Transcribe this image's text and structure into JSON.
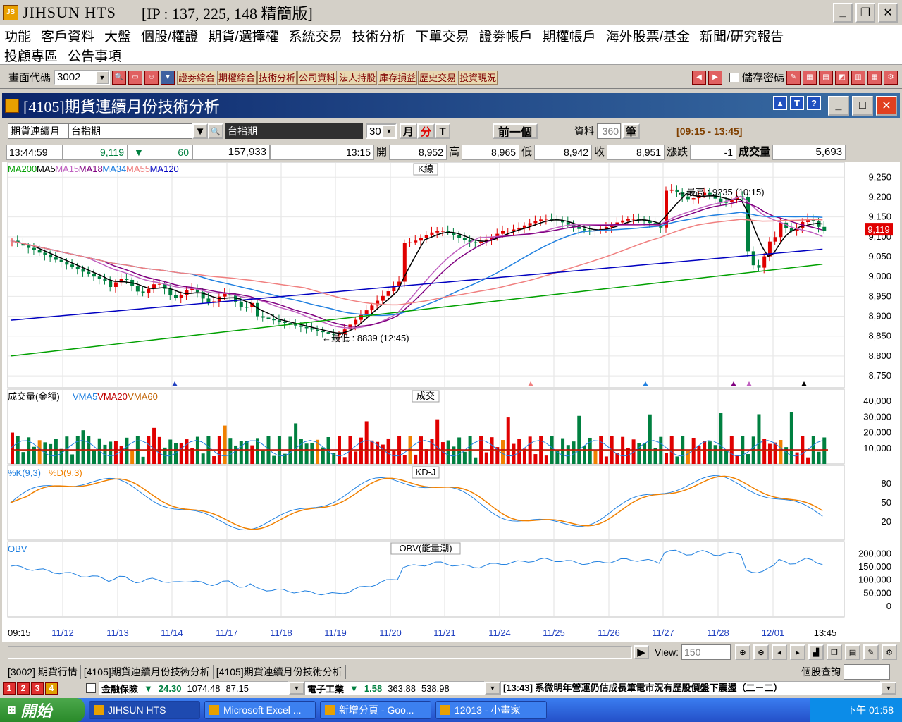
{
  "window": {
    "app_title": "JIHSUN HTS",
    "server_info": "[IP : 137, 225, 148 精簡版]"
  },
  "menu": {
    "row1": [
      "功能",
      "客戶資料",
      "大盤",
      "個股/權證",
      "期貨/選擇權",
      "系統交易",
      "技術分析",
      "下單交易",
      "證劵帳戶",
      "期權帳戶",
      "海外股票/基金",
      "新聞/研究報告"
    ],
    "row2": [
      "投顧專區",
      "公告事項"
    ]
  },
  "toolbar": {
    "code_label": "畫面代碼",
    "code_value": "3002",
    "shortcuts": [
      "證劵綜合",
      "期權綜合",
      "技術分析",
      "公司資料",
      "法人持股",
      "庫存損益",
      "歷史交易",
      "投資現況"
    ],
    "save_password_label": "儲存密碼"
  },
  "subwindow": {
    "title": "[4105]期貨連續月份技術分析"
  },
  "controls": {
    "product_type": "期貨連續月",
    "product_name": "台指期",
    "product_display": "台指期",
    "interval": "30",
    "unit_month": "月",
    "unit_minute": "分",
    "unit_tick": "T",
    "prev_button": "前一個",
    "data_label": "資料",
    "data_count": "360",
    "data_unit": "筆",
    "session": "[09:15 - 13:45]"
  },
  "quote": {
    "time": "13:44:59",
    "price": "9,119",
    "change": "60",
    "volume_total": "157,933",
    "bar_time": "13:15",
    "open_label": "開",
    "open": "8,952",
    "high_label": "高",
    "high": "8,965",
    "low_label": "低",
    "low": "8,942",
    "close_label": "收",
    "close": "8,951",
    "change_label": "漲跌",
    "bar_change": "-1",
    "vol_label": "成交量",
    "bar_volume": "5,693"
  },
  "chart_data": [
    {
      "type": "line",
      "title": "K線",
      "legend": [
        "MA200",
        "MA5",
        "MA15",
        "MA18",
        "MA34",
        "MA55",
        "MA120"
      ],
      "y_ticks": [
        "9,250",
        "9,200",
        "9,150",
        "9,100",
        "9,050",
        "9,000",
        "8,950",
        "8,900",
        "8,850",
        "8,800",
        "8,750"
      ],
      "ylim": [
        8720,
        9270
      ],
      "last_price_tag": "9,119",
      "annotations": [
        "最高 : 9235 (10:15)",
        "最低 : 8839 (12:45)"
      ],
      "x_labels": [
        "09:15",
        "11/12",
        "11/13",
        "11/14",
        "11/17",
        "11/18",
        "11/19",
        "11/20",
        "11/21",
        "11/24",
        "11/25",
        "11/26",
        "11/27",
        "11/28",
        "12/01",
        "13:45"
      ]
    },
    {
      "type": "bar",
      "title": "成交",
      "legend": [
        "成交量(金額)",
        "VMA5",
        "VMA20",
        "VMA60"
      ],
      "y_ticks": [
        "40,000",
        "30,000",
        "20,000",
        "10,000"
      ]
    },
    {
      "type": "line",
      "title": "KD-J",
      "legend": [
        "%K(9,3)",
        "%D(9,3)"
      ],
      "y_ticks": [
        "80",
        "50",
        "20"
      ]
    },
    {
      "type": "line",
      "title": "OBV(能量潮)",
      "legend": [
        "OBV"
      ],
      "y_ticks": [
        "200,000",
        "150,000",
        "100,000",
        "50,000",
        "0"
      ]
    }
  ],
  "bottom": {
    "view_label": "View:",
    "view_value": "150"
  },
  "tabs": [
    "[3002] 期貨行情",
    "[4105]期貨連續月份技術分析",
    "[4105]期貨連續月份技術分析"
  ],
  "stock_query": "個股查詢",
  "ticker": {
    "nums": [
      "1",
      "2",
      "3",
      "4"
    ],
    "sector1_name": "金融保險",
    "sector1_change": "24.30",
    "sector1_value": "1074.48",
    "sector1_vol": "87.15",
    "sector2_name": "電子工業",
    "sector2_change": "1.58",
    "sector2_value": "363.88",
    "sector2_vol": "538.98",
    "news": "[13:43] 系微明年營運仍估成長筆電市況有歷股價盤下震盪（二－二）"
  },
  "taskbar": {
    "start": "開始",
    "items": [
      "JIHSUN HTS",
      "Microsoft Excel ...",
      "新增分頁 - Goo...",
      "12013 - 小畫家"
    ],
    "clock": "下午 01:58"
  },
  "colors": {
    "up": "#e00000",
    "down": "#008040",
    "ma200": "#00a000",
    "ma5": "#000000",
    "ma15": "#c060c0",
    "ma18": "#800080",
    "ma34": "#2080e0",
    "ma55": "#f08080",
    "ma120": "#0000c0"
  }
}
